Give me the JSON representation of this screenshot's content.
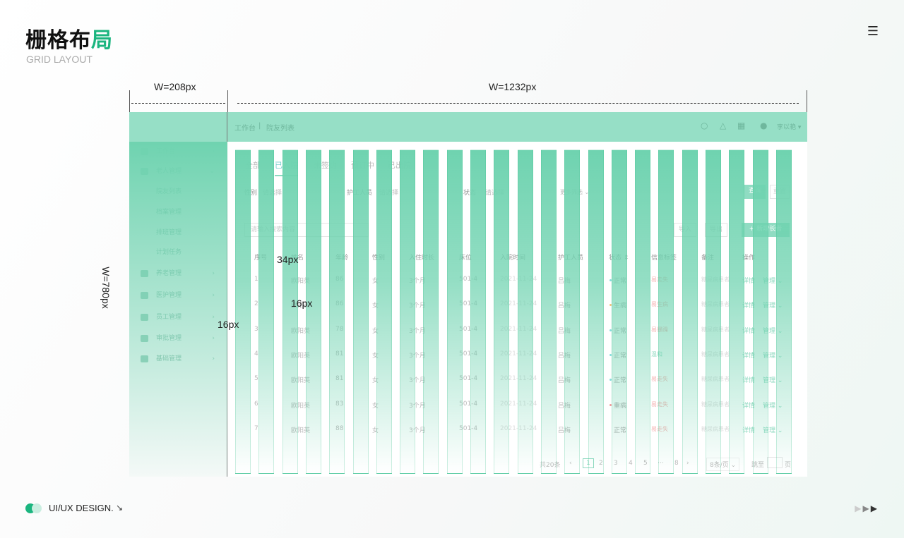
{
  "slide": {
    "title_main": "栅格布",
    "title_accent": "局",
    "subtitle": "GRID LAYOUT",
    "menu_icon": "hamburger-icon",
    "measure_sidebar": "W=208px",
    "measure_content": "W=1232px",
    "measure_height": "W=780px",
    "annot_gutter": "34px",
    "annot_a": "16px",
    "annot_b": "16px",
    "footer_label": "UI/UX DESIGN.",
    "footer_arrow": "↘",
    "accent": "#1bb57f",
    "grid_color": "#6fd3b0"
  },
  "sidebar": {
    "items": [
      {
        "label": "工作台",
        "icon": "dashboard-icon",
        "chev": "›"
      },
      {
        "label": "老人管理",
        "icon": "elder-icon",
        "chev": "⌄"
      },
      {
        "label": "院友列表",
        "sub": true
      },
      {
        "label": "档案管理",
        "sub": true
      },
      {
        "label": "排班管理",
        "sub": true
      },
      {
        "label": "计划任务",
        "sub": true
      },
      {
        "label": "养老管理",
        "icon": "heart-icon",
        "chev": "›"
      },
      {
        "label": "医护管理",
        "icon": "nurse-icon",
        "chev": "›"
      },
      {
        "label": "员工管理",
        "icon": "staff-icon",
        "chev": "›"
      },
      {
        "label": "审批管理",
        "icon": "approval-icon",
        "chev": "›"
      },
      {
        "label": "基础管理",
        "icon": "grid-icon",
        "chev": "›"
      }
    ]
  },
  "header": {
    "crumb1": "工作台",
    "sep": "|",
    "crumb2": "院友列表",
    "user": "李以艳 ▾"
  },
  "tabs": [
    "全部",
    "已入院",
    "未签约",
    "预订中",
    "已出院"
  ],
  "filters": {
    "gender_label": "性别",
    "gender_ph": "请选择",
    "nurse_label": "护工人员",
    "nurse_ph": "请选择",
    "status_label": "状态",
    "status_ph": "请选择",
    "more": "更多筛选 ⌄",
    "query": "查询",
    "reset": "重置"
  },
  "search": {
    "placeholder": "请输入搜索内容",
    "import": "导入",
    "export": "导出",
    "add": "+ 新增长者"
  },
  "table": {
    "headers": [
      "序号",
      "姓名",
      "年龄",
      "性别",
      "入住时长",
      "床位",
      "入院时间",
      "护工人员",
      "状态 ⇕",
      "信息标签",
      "备注",
      "操作"
    ],
    "rows": [
      [
        "1",
        "欧阳英",
        "86",
        "女",
        "3个月",
        "501-4",
        "2021-11-24",
        "吕梅",
        "正常",
        "易走失",
        "糖尿病患者",
        "详情",
        "管理 ⌄"
      ],
      [
        "2",
        "欧阳英",
        "86",
        "女",
        "3个月",
        "501-4",
        "2021-11-24",
        "吕梅",
        "生病",
        "易生病",
        "糖尿病患者",
        "详情",
        "管理 ⌄"
      ],
      [
        "3",
        "欧阳英",
        "78",
        "女",
        "3个月",
        "501-4",
        "2021-11-24",
        "吕梅",
        "正常",
        "易暴躁",
        "糖尿病患者",
        "详情",
        "管理 ⌄"
      ],
      [
        "4",
        "欧阳英",
        "81",
        "女",
        "3个月",
        "501-4",
        "2021-11-24",
        "吕梅",
        "正常",
        "温和",
        "糖尿病患者",
        "详情",
        "管理 ⌄"
      ],
      [
        "5",
        "欧阳英",
        "81",
        "女",
        "3个月",
        "501-4",
        "2021-11-24",
        "吕梅",
        "正常",
        "易走失",
        "糖尿病患者",
        "详情",
        "管理 ⌄"
      ],
      [
        "6",
        "欧阳英",
        "83",
        "女",
        "3个月",
        "501-4",
        "2021-11-24",
        "吕梅",
        "重病",
        "易走失",
        "糖尿病患者",
        "详情",
        "管理 ⌄"
      ],
      [
        "7",
        "欧阳英",
        "88",
        "女",
        "3个月",
        "501-4",
        "2021-11-24",
        "吕梅",
        "正常",
        "易走失",
        "糖尿病患者",
        "详情",
        "管理 ⌄"
      ]
    ]
  },
  "pagination": {
    "total": "共20条",
    "prev": "‹",
    "pages": [
      "1",
      "2",
      "3",
      "4",
      "5",
      "···",
      "8"
    ],
    "next": "›",
    "size": "8条/页 ⌄",
    "goto": "跳至",
    "page_unit": "页"
  }
}
